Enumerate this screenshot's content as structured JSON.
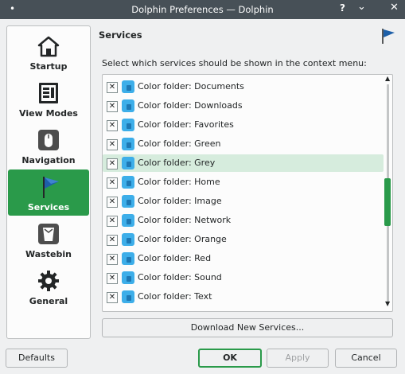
{
  "window": {
    "title": "Dolphin Preferences — Dolphin",
    "menu_glyph": "•",
    "help_glyph": "?",
    "minimize_glyph": "⌄",
    "close_glyph": "✕"
  },
  "sidebar": {
    "items": [
      {
        "label": "Startup",
        "icon": "house-icon"
      },
      {
        "label": "View Modes",
        "icon": "view-modes-icon"
      },
      {
        "label": "Navigation",
        "icon": "mouse-icon"
      },
      {
        "label": "Services",
        "icon": "flag-icon",
        "active": true
      },
      {
        "label": "Wastebin",
        "icon": "wastebin-icon"
      },
      {
        "label": "General",
        "icon": "gear-icon"
      }
    ]
  },
  "main": {
    "heading": "Services",
    "description": "Select which services should be shown in the context menu:",
    "services": [
      {
        "label": "Color folder: Documents",
        "checked": true
      },
      {
        "label": "Color folder: Downloads",
        "checked": true
      },
      {
        "label": "Color folder: Favorites",
        "checked": true
      },
      {
        "label": "Color folder: Green",
        "checked": true
      },
      {
        "label": "Color folder: Grey",
        "checked": true,
        "selected": true
      },
      {
        "label": "Color folder: Home",
        "checked": true
      },
      {
        "label": "Color folder: Image",
        "checked": true
      },
      {
        "label": "Color folder: Network",
        "checked": true
      },
      {
        "label": "Color folder: Orange",
        "checked": true
      },
      {
        "label": "Color folder: Red",
        "checked": true
      },
      {
        "label": "Color folder: Sound",
        "checked": true
      },
      {
        "label": "Color folder: Text",
        "checked": true
      }
    ],
    "check_glyph": "✕",
    "download_label": "Download New Services..."
  },
  "buttons": {
    "defaults": "Defaults",
    "ok": "OK",
    "apply": "Apply",
    "cancel": "Cancel"
  },
  "colors": {
    "accent": "#2a9a4a",
    "titlebar": "#475057",
    "folder": "#3daee9"
  }
}
